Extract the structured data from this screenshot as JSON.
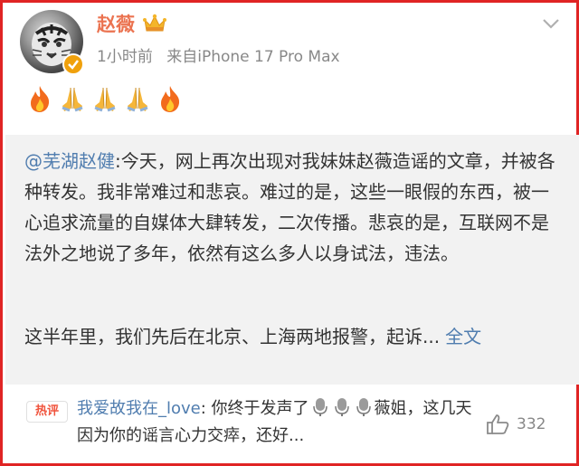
{
  "post": {
    "author": "赵薇",
    "time": "1小时前",
    "source": "来自iPhone 17 Pro Max",
    "emojis": [
      "fire-icon",
      "pray-icon",
      "pray-icon",
      "pray-icon",
      "fire-icon"
    ]
  },
  "repost": {
    "mention": "@芜湖赵健",
    "text": ":今天，网上再次出现对我妹妹赵薇造谣的文章，并被各种转发。我非常难过和悲哀。难过的是，这些一眼假的东西，被一心追求流量的自媒体大肆转发，二次传播。悲哀的是，互联网不是法外之地说了多年，依然有这么多人以身试法，违法。",
    "text2": "这半年里，我们先后在北京、上海两地报警，起诉...",
    "more_link": "全文"
  },
  "hot_comment": {
    "tag": "热评",
    "user": "我爱故我在_love",
    "text_a": ": 你终于发声了",
    "mic_icons": [
      "microphone-icon",
      "microphone-icon",
      "microphone-icon"
    ],
    "text_b": "薇姐，这几天因为你的谣言心力交瘁，还好...",
    "likes": "332"
  },
  "colors": {
    "name": "#eb7350",
    "link": "#507daf",
    "border": "#e02424",
    "verified": "#f0a10c",
    "hot_tag": "#f0533c"
  }
}
